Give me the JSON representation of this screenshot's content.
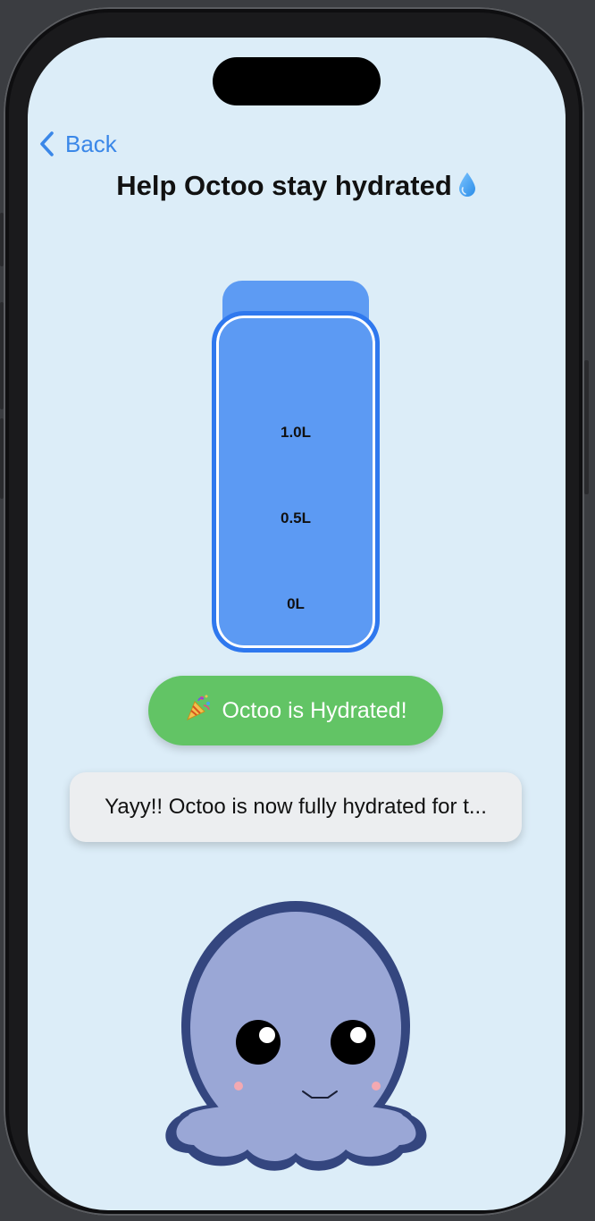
{
  "nav": {
    "back_label": "Back"
  },
  "header": {
    "title": "Help Octoo stay hydrated",
    "title_icon": "water-drop-icon"
  },
  "bottle": {
    "marks": [
      "1.0L",
      "0.5L",
      "0L"
    ]
  },
  "status_button": {
    "label": "Octoo is Hydrated!",
    "icon": "party-popper-icon"
  },
  "message": {
    "text": "Yayy!! Octoo is now fully hydrated for t..."
  },
  "colors": {
    "screen_bg": "#dcedf8",
    "accent": "#3a87e8",
    "bottle": "#5c9af3",
    "bottle_border": "#2f78ee",
    "success": "#62c465",
    "octopus_body": "#9aa7d6",
    "octopus_outline": "#34467f"
  }
}
